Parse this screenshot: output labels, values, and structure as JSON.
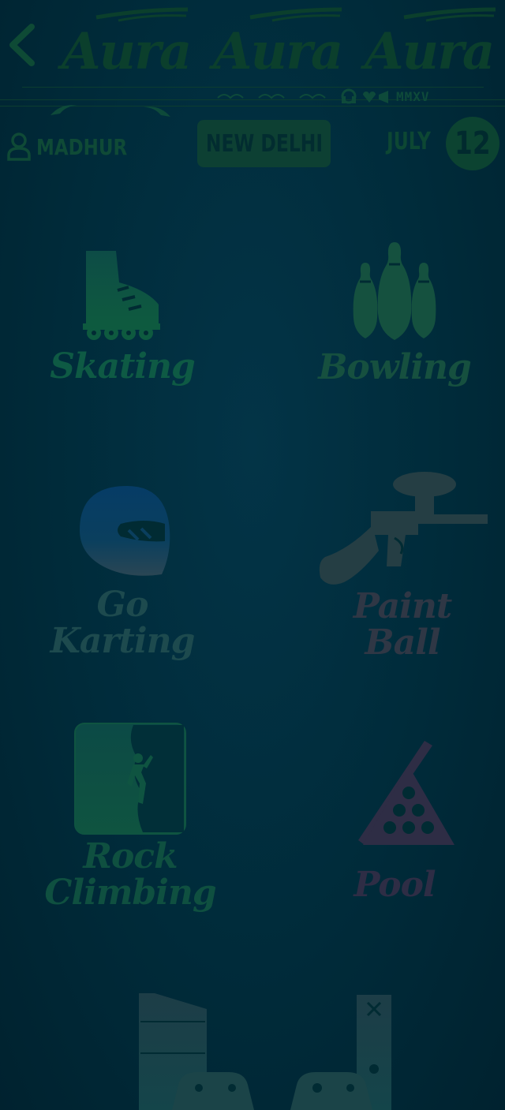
{
  "header": {
    "back_label": "Back",
    "logo_words": [
      "Aura",
      "Aura",
      "Aura"
    ],
    "deco_text": "MMXV"
  },
  "user": {
    "name": "MADHUR"
  },
  "city": {
    "label": "NEW DELHI"
  },
  "date": {
    "month": "JULY",
    "day": "12"
  },
  "activities": [
    {
      "label_lines": [
        "Skating"
      ],
      "icon": "inline-skate-icon",
      "color": "#0e5a44"
    },
    {
      "label_lines": [
        "Bowling"
      ],
      "icon": "bowling-pins-icon",
      "color": "#16503f"
    },
    {
      "label_lines": [
        "Go",
        "Karting"
      ],
      "icon": "racing-helmet-icon",
      "color": "#1d4a4e"
    },
    {
      "label_lines": [
        "Paint",
        "Ball"
      ],
      "icon": "paintball-gun-icon",
      "color": "#2a3a44"
    },
    {
      "label_lines": [
        "Rock",
        "Climbing"
      ],
      "icon": "rock-climber-icon",
      "color": "#0f5040"
    },
    {
      "label_lines": [
        "Pool"
      ],
      "icon": "pool-cue-rack-icon",
      "color": "#2e2d45"
    }
  ],
  "gaming": {
    "icon": "game-consoles-icon"
  }
}
